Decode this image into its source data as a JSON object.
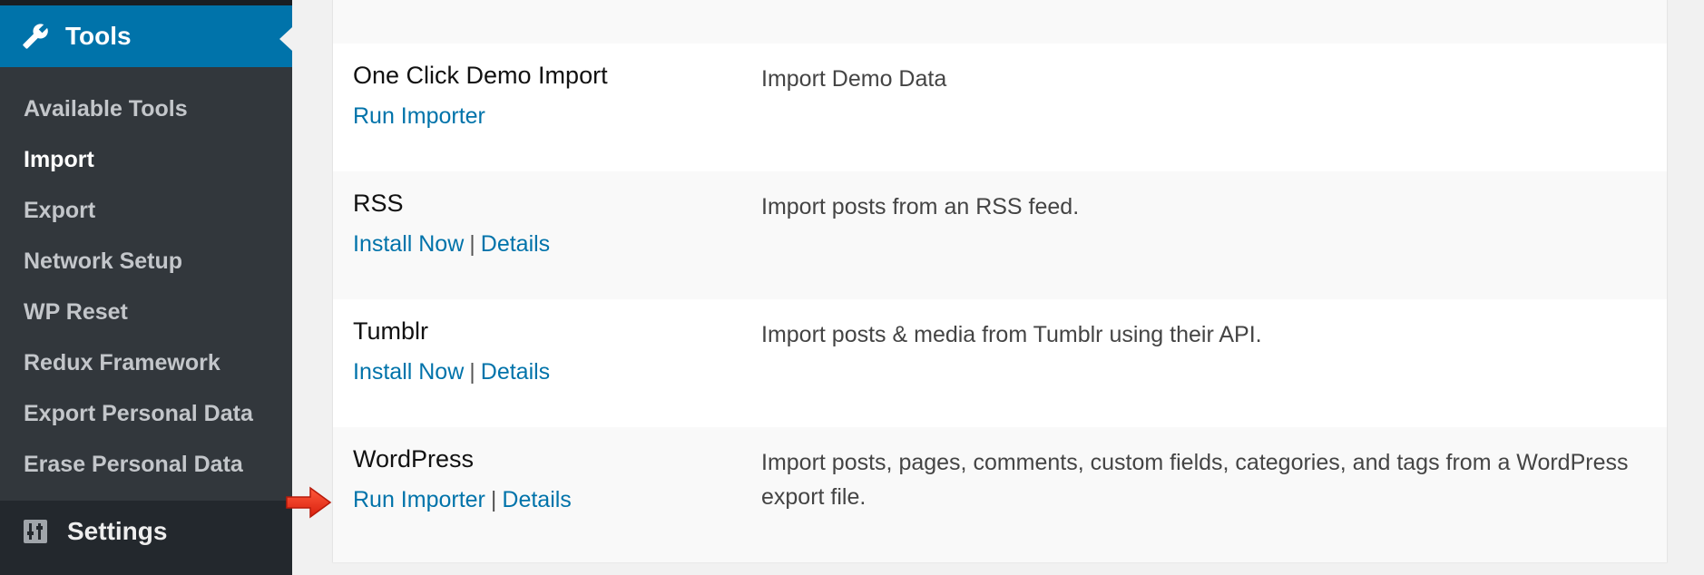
{
  "sidebar": {
    "tools_label": "Tools",
    "submenu": [
      {
        "label": "Available Tools",
        "current": false
      },
      {
        "label": "Import",
        "current": true
      },
      {
        "label": "Export",
        "current": false
      },
      {
        "label": "Network Setup",
        "current": false
      },
      {
        "label": "WP Reset",
        "current": false
      },
      {
        "label": "Redux Framework",
        "current": false
      },
      {
        "label": "Export Personal Data",
        "current": false
      },
      {
        "label": "Erase Personal Data",
        "current": false
      }
    ],
    "settings_label": "Settings"
  },
  "importers": [
    {
      "name": "One Click Demo Import",
      "actions": [
        "Run Importer"
      ],
      "description": "Import Demo Data"
    },
    {
      "name": "RSS",
      "actions": [
        "Install Now",
        "Details"
      ],
      "description": "Import posts from an RSS feed."
    },
    {
      "name": "Tumblr",
      "actions": [
        "Install Now",
        "Details"
      ],
      "description": "Import posts & media from Tumblr using their API."
    },
    {
      "name": "WordPress",
      "actions": [
        "Run Importer",
        "Details"
      ],
      "description": "Import posts, pages, comments, custom fields, categories, and tags from a WordPress export file."
    }
  ],
  "action_separator": "|",
  "colors": {
    "accent": "#0073aa",
    "sidebar": "#23282d",
    "submenu": "#32373c",
    "arrow": "#e8301b"
  },
  "icons": {
    "tools": "wrench-icon",
    "settings": "sliders-icon",
    "pointer": "red-arrow-icon"
  }
}
